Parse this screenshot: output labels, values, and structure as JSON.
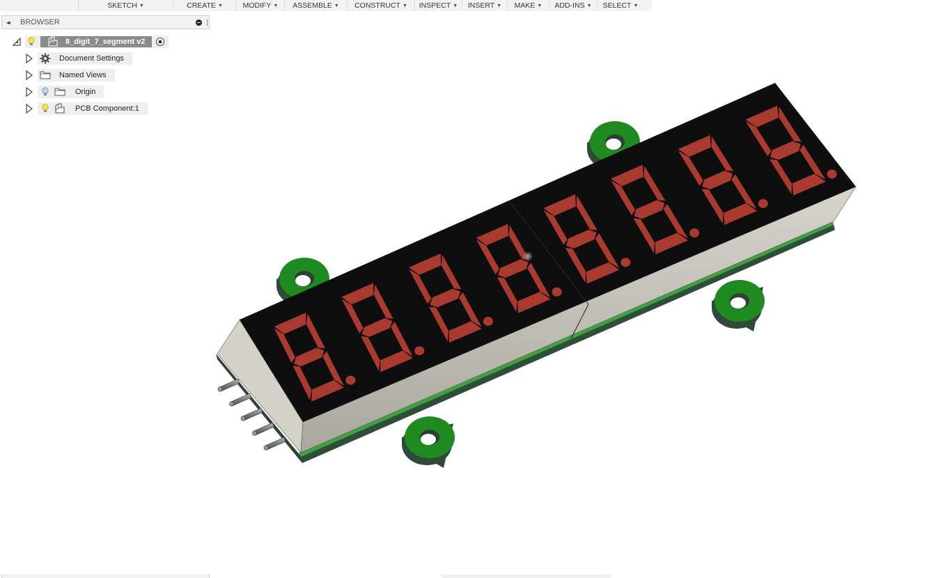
{
  "toolbar": {
    "items": [
      {
        "label": "SKETCH",
        "caret": "▼"
      },
      {
        "label": "CREATE",
        "caret": "▼"
      },
      {
        "label": "MODIFY",
        "caret": "▼"
      },
      {
        "label": "ASSEMBLE",
        "caret": "▼"
      },
      {
        "label": "CONSTRUCT",
        "caret": "▼"
      },
      {
        "label": "INSPECT",
        "caret": "▼"
      },
      {
        "label": "INSERT",
        "caret": "▼"
      },
      {
        "label": "MAKE",
        "caret": "▼"
      },
      {
        "label": "ADD-INS",
        "caret": "▼"
      },
      {
        "label": "SELECT",
        "caret": "▼"
      }
    ]
  },
  "browser": {
    "collapse_icon": "◂◂",
    "title": "BROWSER",
    "root": {
      "label": "8_digit_7_segment v2",
      "light": "lightbulb-on-icon",
      "icon": "component-icon",
      "activate": "radio-active-icon"
    },
    "items": [
      {
        "label": "Document Settings",
        "icon": "gear-icon",
        "light": null
      },
      {
        "label": "Named Views",
        "icon": "folder-icon",
        "light": null
      },
      {
        "label": "Origin",
        "icon": "folder-icon",
        "light": "lightbulb-off-icon"
      },
      {
        "label": "PCB Component:1",
        "icon": "component-icon",
        "light": "lightbulb-on-icon"
      }
    ]
  },
  "model": {
    "name": "8-digit 7-segment display module",
    "digit_count": 8,
    "digits": [
      "8.",
      "8.",
      "8.",
      "8.",
      "8.",
      "8.",
      "8.",
      "8."
    ],
    "modules": 2,
    "header_pins": 5,
    "mounting_lugs": 4,
    "colors": {
      "display_top": "#0d0d0d",
      "segment_on": "#a93a30",
      "display_side": "#cfcdc3",
      "display_end": "#d6d3c8",
      "pcb_green": "#1f8a1f",
      "pcb_edge": "#2f4a3a",
      "pin": "#8a8a84"
    }
  }
}
